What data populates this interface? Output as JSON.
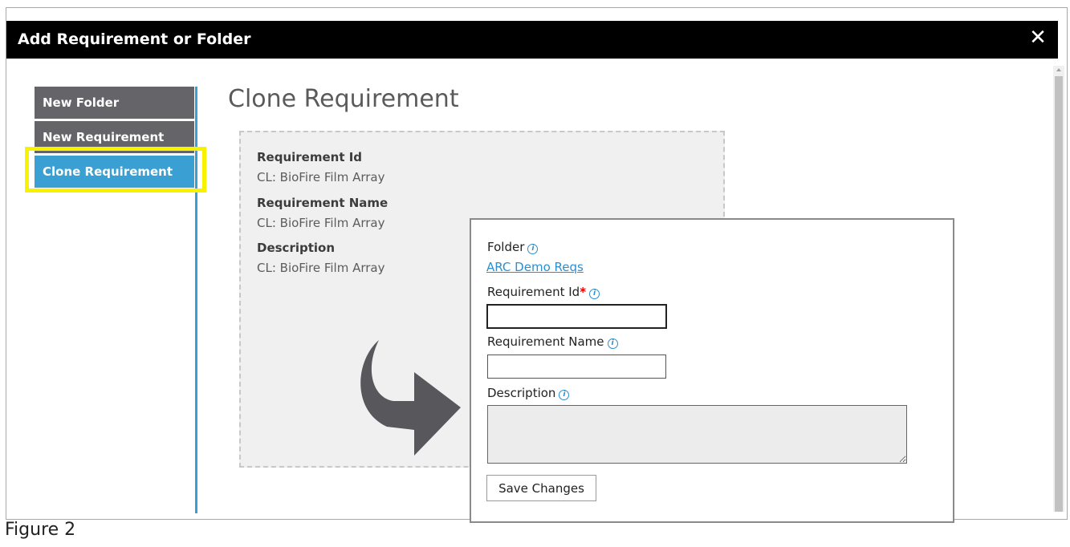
{
  "dialog": {
    "title": "Add Requirement or Folder",
    "close_symbol": "✕"
  },
  "sidebar": {
    "items": [
      {
        "label": "New Folder",
        "active": false
      },
      {
        "label": "New Requirement",
        "active": false
      },
      {
        "label": "Clone Requirement",
        "active": true
      }
    ]
  },
  "main": {
    "title": "Clone Requirement"
  },
  "source": {
    "fields": [
      {
        "label": "Requirement Id",
        "value": "CL: BioFire Film Array"
      },
      {
        "label": "Requirement Name",
        "value": "CL: BioFire Film Array"
      },
      {
        "label": "Description",
        "value": "CL: BioFire Film Array"
      }
    ]
  },
  "form": {
    "folder_label": "Folder",
    "folder_value": "ARC Demo Reqs",
    "req_id_label": "Requirement Id",
    "required_mark": "*",
    "req_id_value": "",
    "req_name_label": "Requirement Name",
    "req_name_value": "",
    "description_label": "Description",
    "description_value": "",
    "info_symbol": "i",
    "save_label": "Save Changes"
  },
  "caption": "Figure 2",
  "colors": {
    "accent": "#3a9fd2",
    "sidebar_item": "#646469",
    "highlight": "#f6f200",
    "titlebar": "#000000",
    "required": "#e00000"
  },
  "icons": [
    "close-icon",
    "info-icon",
    "curved-arrow-icon"
  ]
}
